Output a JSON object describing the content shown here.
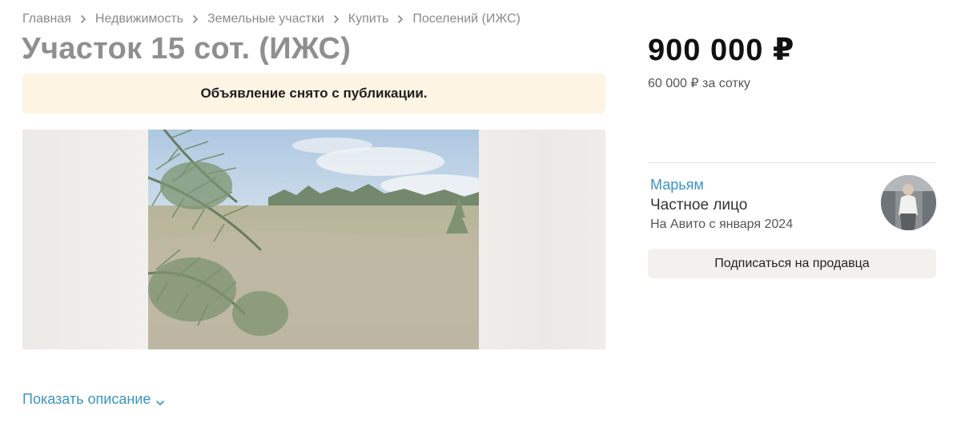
{
  "breadcrumb": [
    {
      "label": "Главная"
    },
    {
      "label": "Недвижимость"
    },
    {
      "label": "Земельные участки"
    },
    {
      "label": "Купить"
    },
    {
      "label": "Поселений (ИЖС)"
    }
  ],
  "listing": {
    "title": "Участок 15 сот. (ИЖС)",
    "notice": "Объявление снято с публикации.",
    "show_description": "Показать описание"
  },
  "price": {
    "total": "900 000 ₽",
    "per_unit": "60 000 ₽ за сотку"
  },
  "seller": {
    "name": "Марьям",
    "type": "Частное лицо",
    "since": "На Авито с января 2024",
    "subscribe_label": "Подписаться на продавца"
  },
  "colors": {
    "link": "#3d93c6",
    "notice_bg": "#fdf4e3",
    "button_bg": "#f2f1ed"
  },
  "icons": {
    "breadcrumb_separator": "chevron-right-icon",
    "description_toggle": "chevron-down-icon"
  }
}
